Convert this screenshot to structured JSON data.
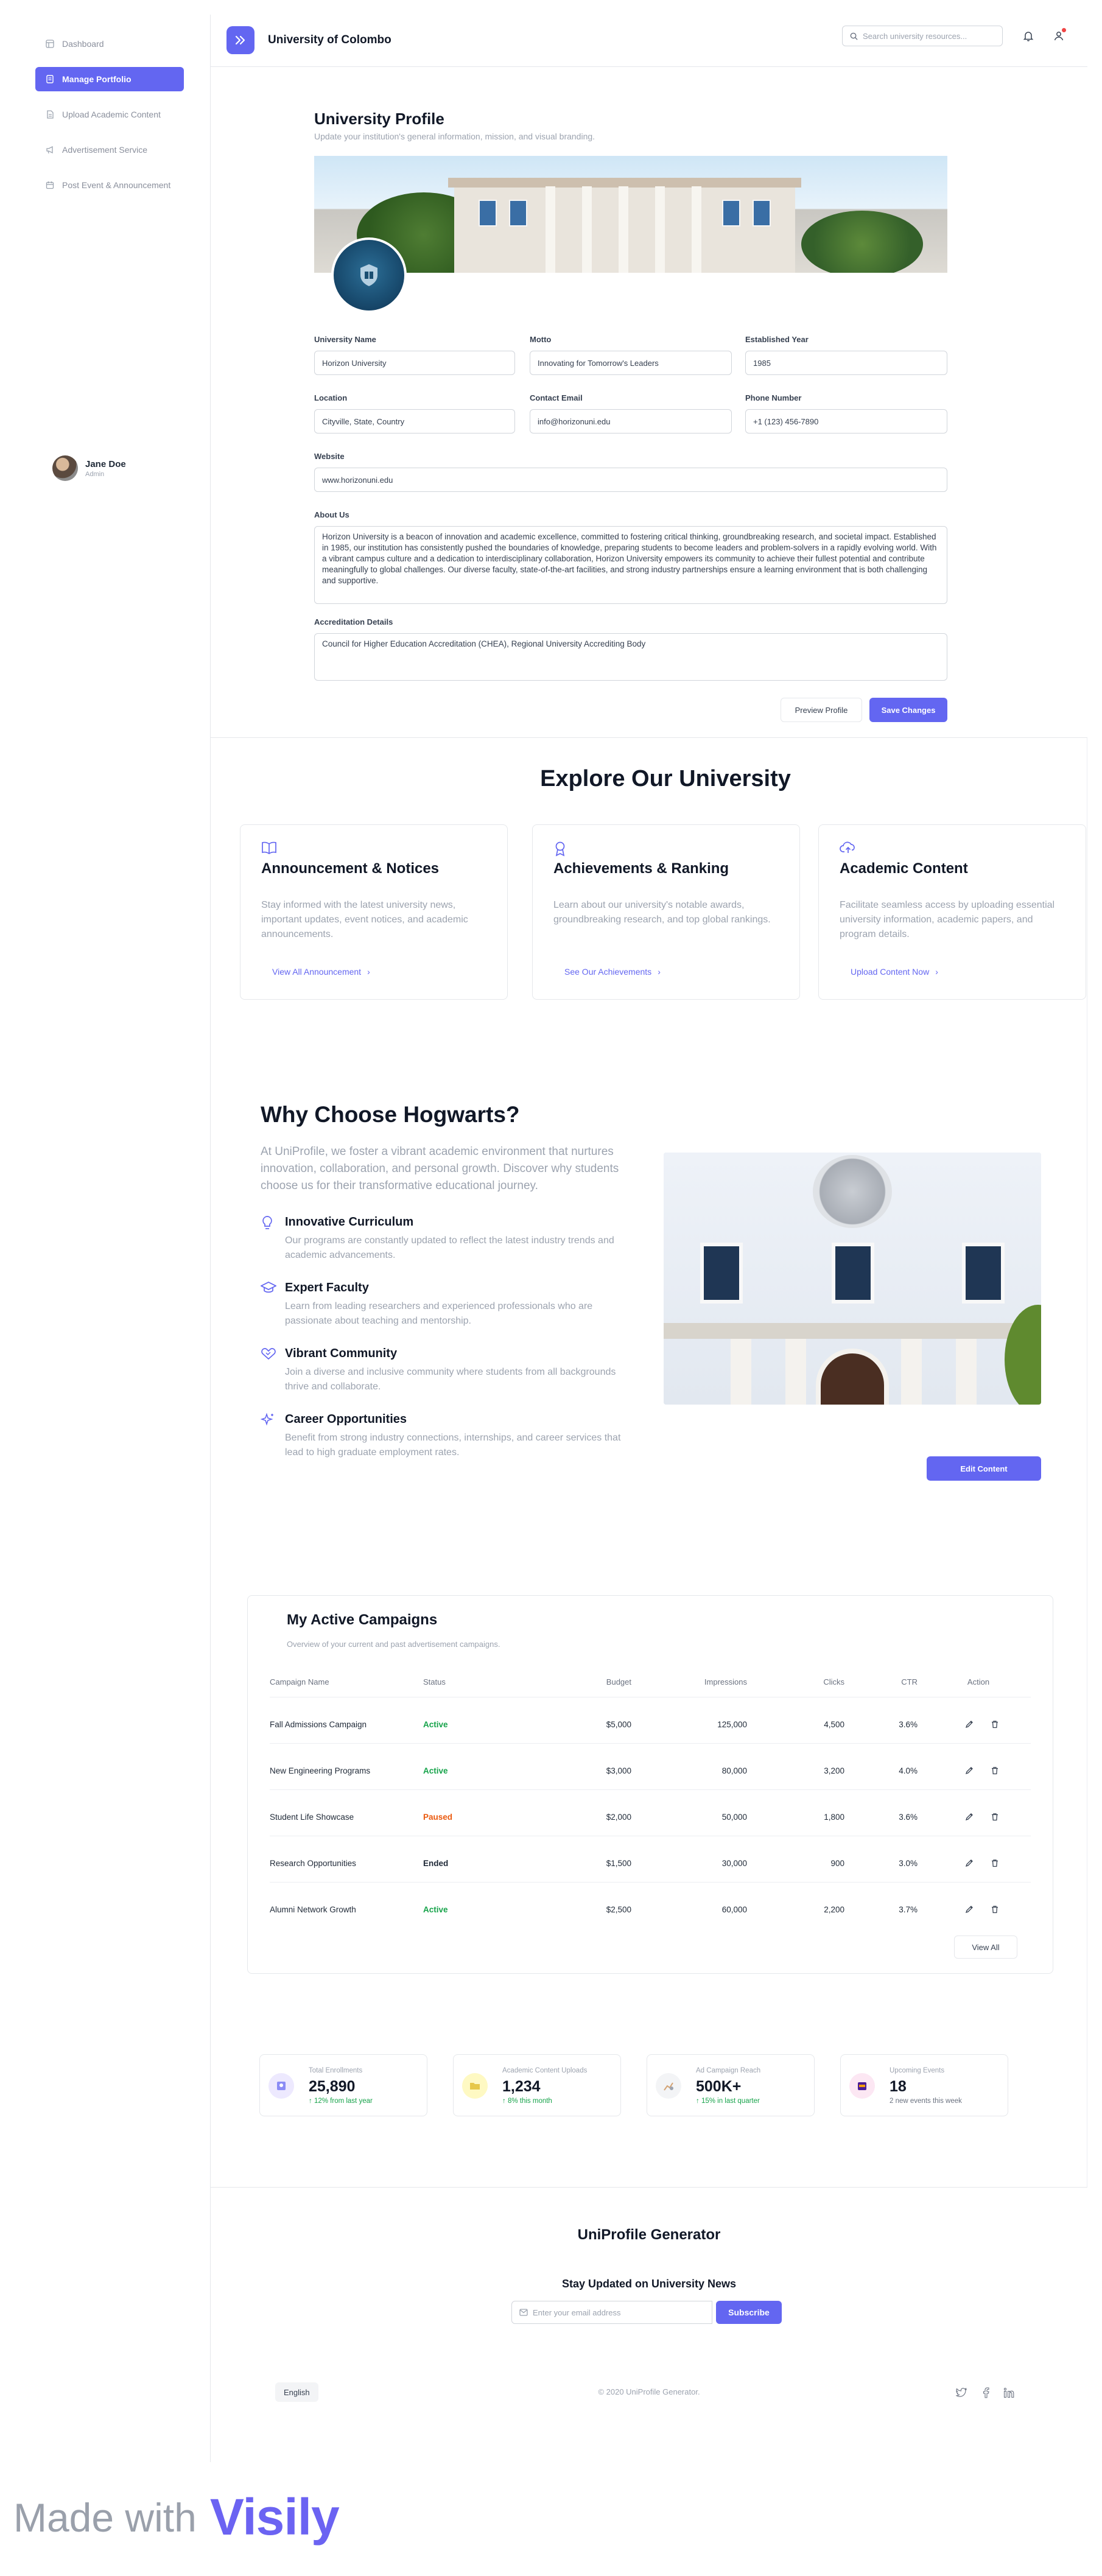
{
  "sidebar": {
    "items": [
      {
        "label": "Dashboard",
        "icon": "dashboard-icon"
      },
      {
        "label": "Manage Portfolio",
        "icon": "portfolio-icon"
      },
      {
        "label": "Upload Academic Content",
        "icon": "document-icon"
      },
      {
        "label": "Advertisement Service",
        "icon": "megaphone-icon"
      },
      {
        "label": "Post Event & Announcement",
        "icon": "calendar-icon"
      }
    ],
    "active_index": 1,
    "user": {
      "name": "Jane Doe",
      "role": "Admin"
    }
  },
  "header": {
    "title": "University of Colombo",
    "search_placeholder": "Search university resources..."
  },
  "profile_form": {
    "title": "University Profile",
    "subtitle": "Update your institution's general information, mission, and visual branding.",
    "fields": {
      "name": {
        "label": "University Name",
        "value": "Horizon University"
      },
      "motto": {
        "label": "Motto",
        "value": "Innovating for Tomorrow's Leaders"
      },
      "established": {
        "label": "Established Year",
        "value": "1985"
      },
      "location": {
        "label": "Location",
        "value": "Cityville, State, Country"
      },
      "email": {
        "label": "Contact Email",
        "value": "info@horizonuni.edu"
      },
      "phone": {
        "label": "Phone Number",
        "value": "+1 (123) 456-7890"
      },
      "website": {
        "label": "Website",
        "value": "www.horizonuni.edu"
      },
      "about": {
        "label": "About Us",
        "value": "Horizon University is a beacon of innovation and academic excellence, committed to fostering critical thinking, groundbreaking research, and societal impact. Established in 1985, our institution has consistently pushed the boundaries of knowledge, preparing students to become leaders and problem-solvers in a rapidly evolving world. With a vibrant campus culture and a dedication to interdisciplinary collaboration, Horizon University empowers its community to achieve their fullest potential and contribute meaningfully to global challenges. Our diverse faculty, state-of-the-art facilities, and strong industry partnerships ensure a learning environment that is both challenging and supportive."
      },
      "accreditation": {
        "label": "Accreditation Details",
        "value": "Council for Higher Education Accreditation (CHEA), Regional University Accrediting Body"
      }
    },
    "preview_label": "Preview Profile",
    "save_label": "Save Changes"
  },
  "explore": {
    "title": "Explore Our University",
    "cards": [
      {
        "icon": "book-open-icon",
        "title": "Announcement & Notices",
        "description": "Stay informed with the latest university news, important updates, event notices, and academic announcements.",
        "link": "View All Announcement"
      },
      {
        "icon": "award-icon",
        "title": "Achievements & Ranking",
        "description": "Learn about our university's notable awards, groundbreaking research, and top global rankings.",
        "link": "See Our Achievements"
      },
      {
        "icon": "cloud-upload-icon",
        "title": "Academic Content",
        "description": "Facilitate seamless access by uploading essential university information, academic papers, and program details.",
        "link": "Upload Content Now"
      }
    ]
  },
  "why": {
    "title": "Why Choose Hogwarts?",
    "intro": "At UniProfile, we foster a vibrant academic environment that nurtures innovation, collaboration, and personal growth. Discover why students choose us for their transformative educational journey.",
    "items": [
      {
        "icon": "lightbulb-icon",
        "title": "Innovative Curriculum",
        "description": "Our programs are constantly updated to reflect the latest industry trends and academic advancements."
      },
      {
        "icon": "graduation-cap-icon",
        "title": "Expert Faculty",
        "description": "Learn from leading researchers and experienced professionals who are passionate about teaching and mentorship."
      },
      {
        "icon": "heart-handshake-icon",
        "title": "Vibrant Community",
        "description": "Join a diverse and inclusive community where students from all backgrounds thrive and collaborate."
      },
      {
        "icon": "sparkles-icon",
        "title": "Career Opportunities",
        "description": "Benefit from strong industry connections, internships, and career services that lead to high graduate employment rates."
      }
    ],
    "edit_label": "Edit Content"
  },
  "campaigns": {
    "title": "My Active Campaigns",
    "subtitle": "Overview of your current and past advertisement campaigns.",
    "columns": [
      "Campaign Name",
      "Status",
      "Budget",
      "Impressions",
      "Clicks",
      "CTR",
      "Action"
    ],
    "rows": [
      {
        "name": "Fall Admissions Campaign",
        "status": "Active",
        "budget": "$5,000",
        "impressions": "125,000",
        "clicks": "4,500",
        "ctr": "3.6%"
      },
      {
        "name": "New Engineering Programs",
        "status": "Active",
        "budget": "$3,000",
        "impressions": "80,000",
        "clicks": "3,200",
        "ctr": "4.0%"
      },
      {
        "name": "Student Life Showcase",
        "status": "Paused",
        "budget": "$2,000",
        "impressions": "50,000",
        "clicks": "1,800",
        "ctr": "3.6%"
      },
      {
        "name": "Research Opportunities",
        "status": "Ended",
        "budget": "$1,500",
        "impressions": "30,000",
        "clicks": "900",
        "ctr": "3.0%"
      },
      {
        "name": "Alumni Network Growth",
        "status": "Active",
        "budget": "$2,500",
        "impressions": "60,000",
        "clicks": "2,200",
        "ctr": "3.7%"
      }
    ],
    "view_all_label": "View All"
  },
  "stats": [
    {
      "label": "Total Enrollments",
      "value": "25,890",
      "change": "12% from last year",
      "icon": "students-icon",
      "color": "#ede9fe"
    },
    {
      "label": "Academic Content Uploads",
      "value": "1,234",
      "change": "8% this month",
      "icon": "upload-folder-icon",
      "color": "#fef9c3"
    },
    {
      "label": "Ad Campaign Reach",
      "value": "500K+",
      "change": "15% in last quarter",
      "icon": "chart-icon",
      "color": "#f3f4f6"
    },
    {
      "label": "Upcoming Events",
      "value": "18",
      "change": "2 new events this week",
      "icon": "calendar-event-icon",
      "color": "#fce7f3"
    }
  ],
  "footer": {
    "brand": "UniProfile Generator",
    "newsletter_title": "Stay Updated on University News",
    "email_placeholder": "Enter your email address",
    "subscribe_label": "Subscribe",
    "language": "English",
    "copyright": "© 2020 UniProfile Generator.",
    "social": [
      "twitter-icon",
      "facebook-icon",
      "linkedin-icon"
    ]
  },
  "watermark": {
    "prefix": "Made with",
    "brand": "Visily"
  },
  "colors": {
    "accent": "#6366f1",
    "active": "#16a34a",
    "paused": "#ea580c"
  }
}
